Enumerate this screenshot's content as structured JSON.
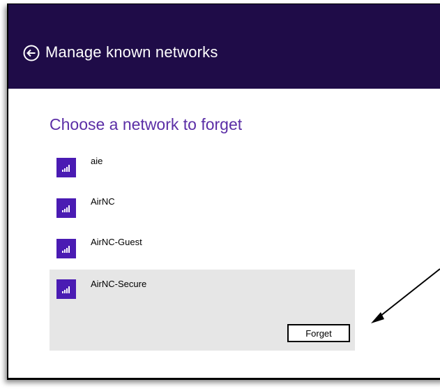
{
  "header": {
    "title": "Manage known networks",
    "back_icon": "back-arrow-circle-icon"
  },
  "subtitle": "Choose a network to forget",
  "networks": [
    {
      "name": "aie",
      "icon": "wifi-signal-icon",
      "selected": false
    },
    {
      "name": "AirNC",
      "icon": "wifi-signal-icon",
      "selected": false
    },
    {
      "name": "AirNC-Guest",
      "icon": "wifi-signal-icon",
      "selected": false
    },
    {
      "name": "AirNC-Secure",
      "icon": "wifi-signal-icon",
      "selected": true
    }
  ],
  "forget_button": {
    "label": "Forget"
  },
  "colors": {
    "header_bg": "#1f0c48",
    "accent_text": "#5b2ea6",
    "tile_bg": "#4a1bb3",
    "selected_bg": "#e6e6e6"
  }
}
